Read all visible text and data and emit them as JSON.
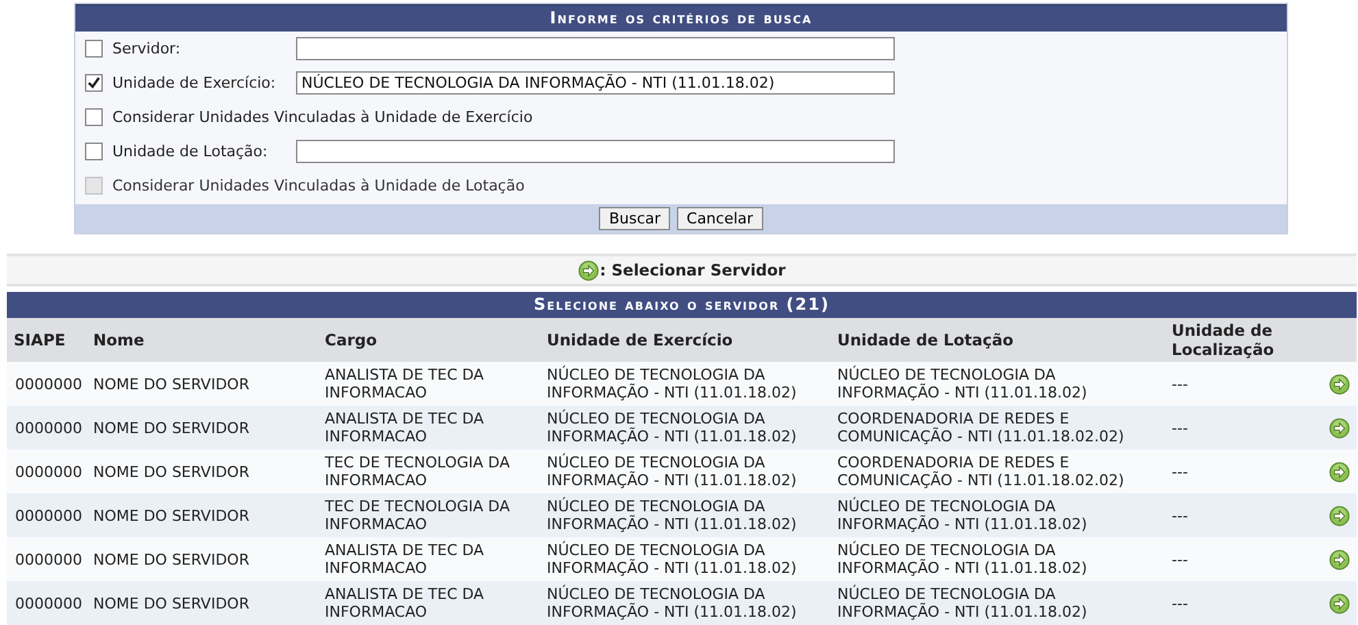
{
  "search_form": {
    "title": "Informe os critérios de busca",
    "criteria": [
      {
        "kind": "field",
        "label": "Servidor:",
        "checked": false,
        "disabled": false
      },
      {
        "kind": "field",
        "label": "Unidade de Exercício:",
        "checked": true,
        "disabled": false,
        "value": "NÚCLEO DE TECNOLOGIA DA INFORMAÇÃO - NTI (11.01.18.02)"
      },
      {
        "kind": "option",
        "label": "Considerar Unidades Vinculadas à Unidade de Exercício",
        "checked": false,
        "disabled": false
      },
      {
        "kind": "field",
        "label": "Unidade de Lotação:",
        "checked": false,
        "disabled": false
      },
      {
        "kind": "option",
        "label": "Considerar Unidades Vinculadas à Unidade de Lotação",
        "checked": false,
        "disabled": true
      }
    ],
    "buttons": [
      "Buscar",
      "Cancelar"
    ]
  },
  "legend": {
    "label": ": Selecionar Servidor"
  },
  "table": {
    "title": "Selecione abaixo o servidor (21)",
    "columns": [
      "SIAPE",
      "Nome",
      "Cargo",
      "Unidade de Exercício",
      "Unidade de Lotação",
      "Unidade de Localização"
    ],
    "rows": [
      {
        "siape": "0000000",
        "nome": "NOME DO SERVIDOR",
        "cargo": "ANALISTA DE TEC DA INFORMACAO",
        "exercicio": "NÚCLEO DE TECNOLOGIA DA INFORMAÇÃO - NTI (11.01.18.02)",
        "lotacao": "NÚCLEO DE TECNOLOGIA DA INFORMAÇÃO - NTI (11.01.18.02)",
        "localizacao": "---"
      },
      {
        "siape": "0000000",
        "nome": "NOME DO SERVIDOR",
        "cargo": "ANALISTA DE TEC DA INFORMACAO",
        "exercicio": "NÚCLEO DE TECNOLOGIA DA INFORMAÇÃO - NTI (11.01.18.02)",
        "lotacao": "COORDENADORIA DE REDES E COMUNICAÇÃO - NTI (11.01.18.02.02)",
        "localizacao": "---"
      },
      {
        "siape": "0000000",
        "nome": "NOME DO SERVIDOR",
        "cargo": "TEC DE TECNOLOGIA DA INFORMACAO",
        "exercicio": "NÚCLEO DE TECNOLOGIA DA INFORMAÇÃO - NTI (11.01.18.02)",
        "lotacao": "COORDENADORIA DE REDES E COMUNICAÇÃO - NTI (11.01.18.02.02)",
        "localizacao": "---"
      },
      {
        "siape": "0000000",
        "nome": "NOME DO SERVIDOR",
        "cargo": "TEC DE TECNOLOGIA DA INFORMACAO",
        "exercicio": "NÚCLEO DE TECNOLOGIA DA INFORMAÇÃO - NTI (11.01.18.02)",
        "lotacao": "NÚCLEO DE TECNOLOGIA DA INFORMAÇÃO - NTI (11.01.18.02)",
        "localizacao": "---"
      },
      {
        "siape": "0000000",
        "nome": "NOME DO SERVIDOR",
        "cargo": "ANALISTA DE TEC DA INFORMACAO",
        "exercicio": "NÚCLEO DE TECNOLOGIA DA INFORMAÇÃO - NTI (11.01.18.02)",
        "lotacao": "NÚCLEO DE TECNOLOGIA DA INFORMAÇÃO - NTI (11.01.18.02)",
        "localizacao": "---"
      },
      {
        "siape": "0000000",
        "nome": "NOME DO SERVIDOR",
        "cargo": "ANALISTA DE TEC DA INFORMACAO",
        "exercicio": "NÚCLEO DE TECNOLOGIA DA INFORMAÇÃO - NTI (11.01.18.02)",
        "lotacao": "NÚCLEO DE TECNOLOGIA DA INFORMAÇÃO - NTI (11.01.18.02)",
        "localizacao": "---"
      }
    ]
  }
}
